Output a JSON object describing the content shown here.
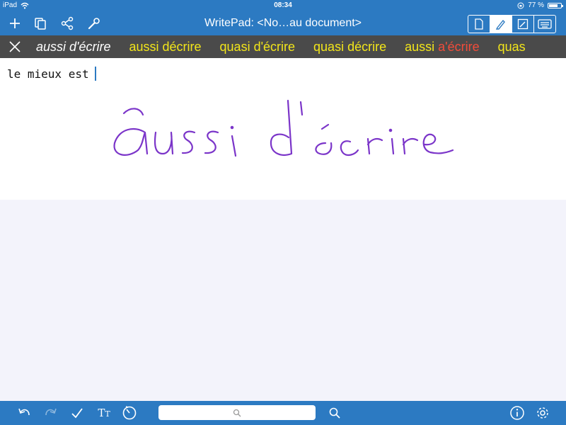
{
  "status": {
    "device": "iPad",
    "time": "08:34",
    "battery": "77 %",
    "battery_level": 0.77
  },
  "nav": {
    "title": "WritePad: <No…au document>",
    "left_icons": [
      "plus-icon",
      "copy-icon",
      "share-icon",
      "wrench-icon"
    ],
    "segments": [
      "document-icon",
      "pen-icon",
      "sketch-icon",
      "keyboard-icon"
    ],
    "active_segment": "pen-icon"
  },
  "suggestions": {
    "items": [
      {
        "text": "aussi d'écrire",
        "selected": true
      },
      {
        "text": "aussi décrire",
        "selected": false
      },
      {
        "text": "quasi d'écrire",
        "selected": false
      },
      {
        "text": "quasi décrire",
        "selected": false
      },
      {
        "pre": "aussi ",
        "highlight": "a'écrire",
        "selected": false
      },
      {
        "text": "quas",
        "selected": false
      }
    ],
    "colors": {
      "normal": "#f2e51a",
      "selected": "#ffffff",
      "highlight": "#f24c3a"
    }
  },
  "document": {
    "typed_text": "le mieux est",
    "ink_color": "#7b35c9"
  },
  "toolbar": {
    "icons": [
      "undo-icon",
      "redo-icon",
      "checkmark-icon",
      "text-size-icon",
      "timer-icon"
    ],
    "text_size_label_big": "T",
    "text_size_label_small": "T",
    "search_placeholder": "",
    "right_icons": [
      "info-icon",
      "gear-icon"
    ]
  },
  "colors": {
    "bar": "#2c7ac2",
    "suggestion_bar": "#4a4a4a",
    "background": "#f3f3fb"
  }
}
